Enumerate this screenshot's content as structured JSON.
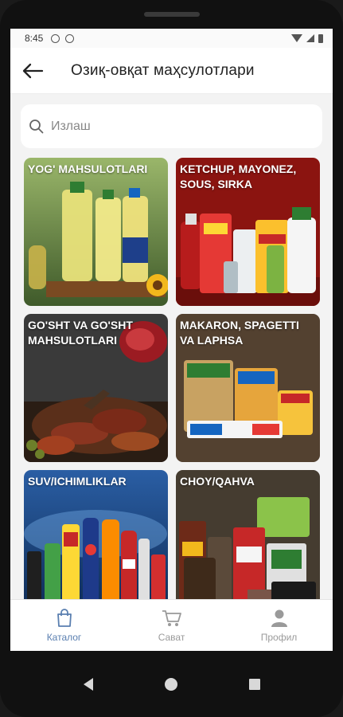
{
  "status_bar": {
    "time": "8:45"
  },
  "header": {
    "title": "Озиқ-овқат маҳсулотлари"
  },
  "search": {
    "placeholder": "Излаш"
  },
  "categories": [
    {
      "label": "YOG' MAHSULOTLARI",
      "bg": "#6d8e46"
    },
    {
      "label": "KETCHUP, MAYONEZ, SOUS, SIRKA",
      "bg": "#8b1410"
    },
    {
      "label": "GO'SHT VA GO'SHT MAHSULOTLARI",
      "bg": "#3a3a3a"
    },
    {
      "label": "MAKARON, SPAGETTI VA LAPHSA",
      "bg": "#4a3a2c"
    },
    {
      "label": "SUV/ICHIMLIKLAR",
      "bg": "#1f4f8e"
    },
    {
      "label": "CHOY/QAHVA",
      "bg": "#3a3228"
    }
  ],
  "bottom_nav": {
    "items": [
      {
        "label": "Каталог",
        "icon": "bag-icon"
      },
      {
        "label": "Сават",
        "icon": "cart-icon"
      },
      {
        "label": "Профил",
        "icon": "profile-icon"
      }
    ]
  },
  "colors": {
    "accent": "#5a7fb0",
    "inactive": "#9a9a9a"
  }
}
